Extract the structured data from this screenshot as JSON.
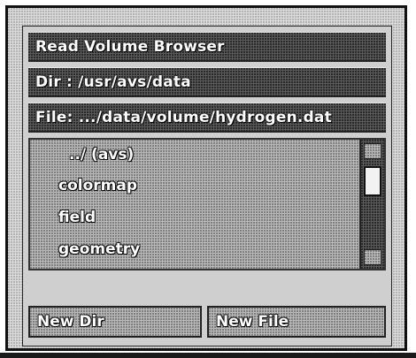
{
  "window": {
    "title": "Read Volume Browser"
  },
  "dir_bar": {
    "label": "Dir : /usr/avs/data"
  },
  "file_bar": {
    "label": "File: .../data/volume/hydrogen.dat"
  },
  "file_list": {
    "items": [
      "../ (avs)",
      "colormap",
      "field",
      "geometry"
    ],
    "scroll_position": 0.15
  },
  "buttons": {
    "new_dir": "New Dir",
    "new_file": "New File"
  },
  "colors": {
    "frame_border": "#111111",
    "bar_fill": "#5a5a5a",
    "panel_fill": "#b9b9b9",
    "text": "#ffffff"
  }
}
